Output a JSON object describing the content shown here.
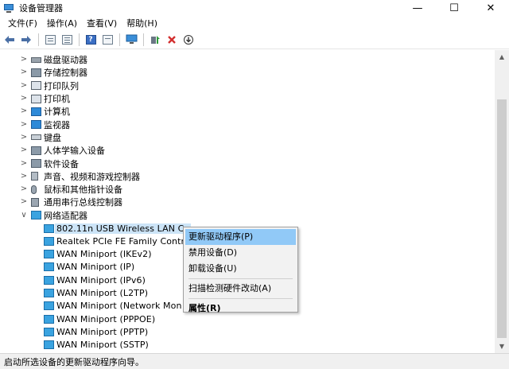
{
  "window": {
    "title": "设备管理器",
    "controls": {
      "minimize": "—",
      "maximize": "☐",
      "close": "✕"
    }
  },
  "menubar": {
    "items": [
      "文件(F)",
      "操作(A)",
      "查看(V)",
      "帮助(H)"
    ]
  },
  "toolbar": {
    "icons": [
      "back-arrow-icon",
      "forward-arrow-icon",
      "properties-sheet-icon",
      "device-view-icon",
      "help-icon",
      "console-view-icon",
      "monitor-scan-icon",
      "update-driver-icon",
      "remove-device-icon",
      "download-arrow-icon"
    ]
  },
  "tree": {
    "categories": [
      {
        "label": "磁盘驱动器",
        "icon": "disk-drive-icon",
        "expanded": false
      },
      {
        "label": "存储控制器",
        "icon": "storage-controller-icon",
        "expanded": false
      },
      {
        "label": "打印队列",
        "icon": "print-queue-icon",
        "expanded": false
      },
      {
        "label": "打印机",
        "icon": "printer-icon",
        "expanded": false
      },
      {
        "label": "计算机",
        "icon": "computer-icon",
        "expanded": false
      },
      {
        "label": "监视器",
        "icon": "monitor-icon",
        "expanded": false
      },
      {
        "label": "键盘",
        "icon": "keyboard-icon",
        "expanded": false
      },
      {
        "label": "人体学输入设备",
        "icon": "hid-icon",
        "expanded": false
      },
      {
        "label": "软件设备",
        "icon": "software-device-icon",
        "expanded": false
      },
      {
        "label": "声音、视频和游戏控制器",
        "icon": "audio-icon",
        "expanded": false
      },
      {
        "label": "鼠标和其他指针设备",
        "icon": "mouse-icon",
        "expanded": false
      },
      {
        "label": "通用串行总线控制器",
        "icon": "usb-icon",
        "expanded": false
      },
      {
        "label": "网络适配器",
        "icon": "network-adapter-icon",
        "expanded": true
      }
    ],
    "network_children": [
      {
        "label": "802.11n USB Wireless LAN Ca",
        "selected": true
      },
      {
        "label": "Realtek PCIe FE Family Contro",
        "selected": false
      },
      {
        "label": "WAN Miniport (IKEv2)",
        "selected": false
      },
      {
        "label": "WAN Miniport (IP)",
        "selected": false
      },
      {
        "label": "WAN Miniport (IPv6)",
        "selected": false
      },
      {
        "label": "WAN Miniport (L2TP)",
        "selected": false
      },
      {
        "label": "WAN Miniport (Network Mon",
        "selected": false
      },
      {
        "label": "WAN Miniport (PPPOE)",
        "selected": false
      },
      {
        "label": "WAN Miniport (PPTP)",
        "selected": false
      },
      {
        "label": "WAN Miniport (SSTP)",
        "selected": false
      }
    ]
  },
  "context_menu": {
    "items": [
      {
        "label": "更新驱动程序(P)",
        "hover": true,
        "bold": false
      },
      {
        "label": "禁用设备(D)",
        "hover": false,
        "bold": false
      },
      {
        "label": "卸载设备(U)",
        "hover": false,
        "bold": false
      },
      {
        "label": "扫描检测硬件改动(A)",
        "hover": false,
        "bold": false
      },
      {
        "label": "属性(R)",
        "hover": false,
        "bold": true
      }
    ]
  },
  "statusbar": {
    "text": "启动所选设备的更新驱动程序向导。"
  },
  "colors": {
    "accent": "#3aa3e0",
    "selection": "#cce4f7",
    "menu_hover": "#91c9f7",
    "remove_red": "#d32f2f",
    "update_green": "#2e9b3a"
  }
}
